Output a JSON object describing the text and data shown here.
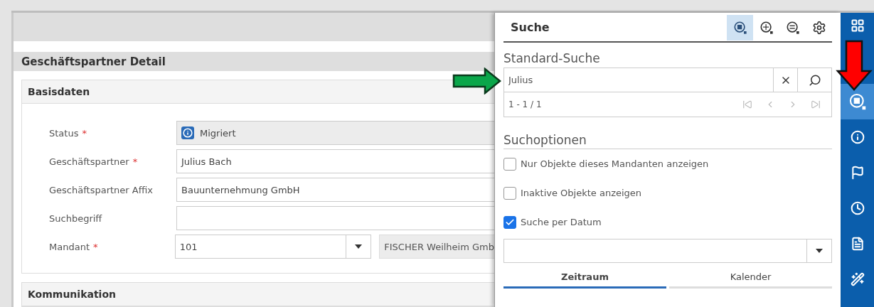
{
  "detail": {
    "title": "Geschäftspartner Detail",
    "sections": [
      {
        "title": "Basisdaten",
        "fields": [
          {
            "kind": "status",
            "label": "Status",
            "marker": "*",
            "value": "Migriert"
          },
          {
            "kind": "text",
            "label": "Geschäftspartner",
            "marker": "*",
            "value": "Julius Bach"
          },
          {
            "kind": "text",
            "label": "Geschäftspartner Affix",
            "value": "Bauunternehmung GmbH"
          },
          {
            "kind": "text",
            "label": "Suchbegriff"
          },
          {
            "kind": "select",
            "label": "Mandant",
            "marker": "*",
            "value": "101",
            "extra": "FISCHER Weilheim Gmb"
          }
        ]
      },
      {
        "title": "Kommunikation"
      }
    ]
  },
  "search_panel": {
    "title": "Suche",
    "toolbar": [
      {
        "kind": "standard",
        "selected": true
      },
      {
        "kind": "extended",
        "selected": false
      },
      {
        "kind": "list",
        "selected": false
      },
      {
        "kind": "settings",
        "selected": false
      }
    ],
    "standard_search": {
      "heading": "Standard-Suche",
      "value": "Julius",
      "result": "1 - 1 / 1"
    },
    "options": {
      "heading": "Suchoptionen",
      "checkboxes": [
        {
          "label": "Nur Objekte dieses Mandanten anzeigen",
          "checked": false
        },
        {
          "label": "Inaktive Objekte anzeigen",
          "checked": false
        },
        {
          "label": "Suche per Datum",
          "checked": true
        }
      ]
    },
    "tabs": [
      {
        "label": "Zeitraum",
        "selected": true
      },
      {
        "label": "Kalender",
        "selected": false
      }
    ]
  },
  "sidebar": [
    {
      "kind": "dashboard",
      "selected": false
    },
    {
      "kind": "search",
      "selected": true
    },
    {
      "kind": "info",
      "selected": false
    },
    {
      "kind": "flag",
      "selected": false
    },
    {
      "kind": "history",
      "selected": false
    },
    {
      "kind": "document",
      "selected": false
    },
    {
      "kind": "wand",
      "selected": false
    }
  ]
}
